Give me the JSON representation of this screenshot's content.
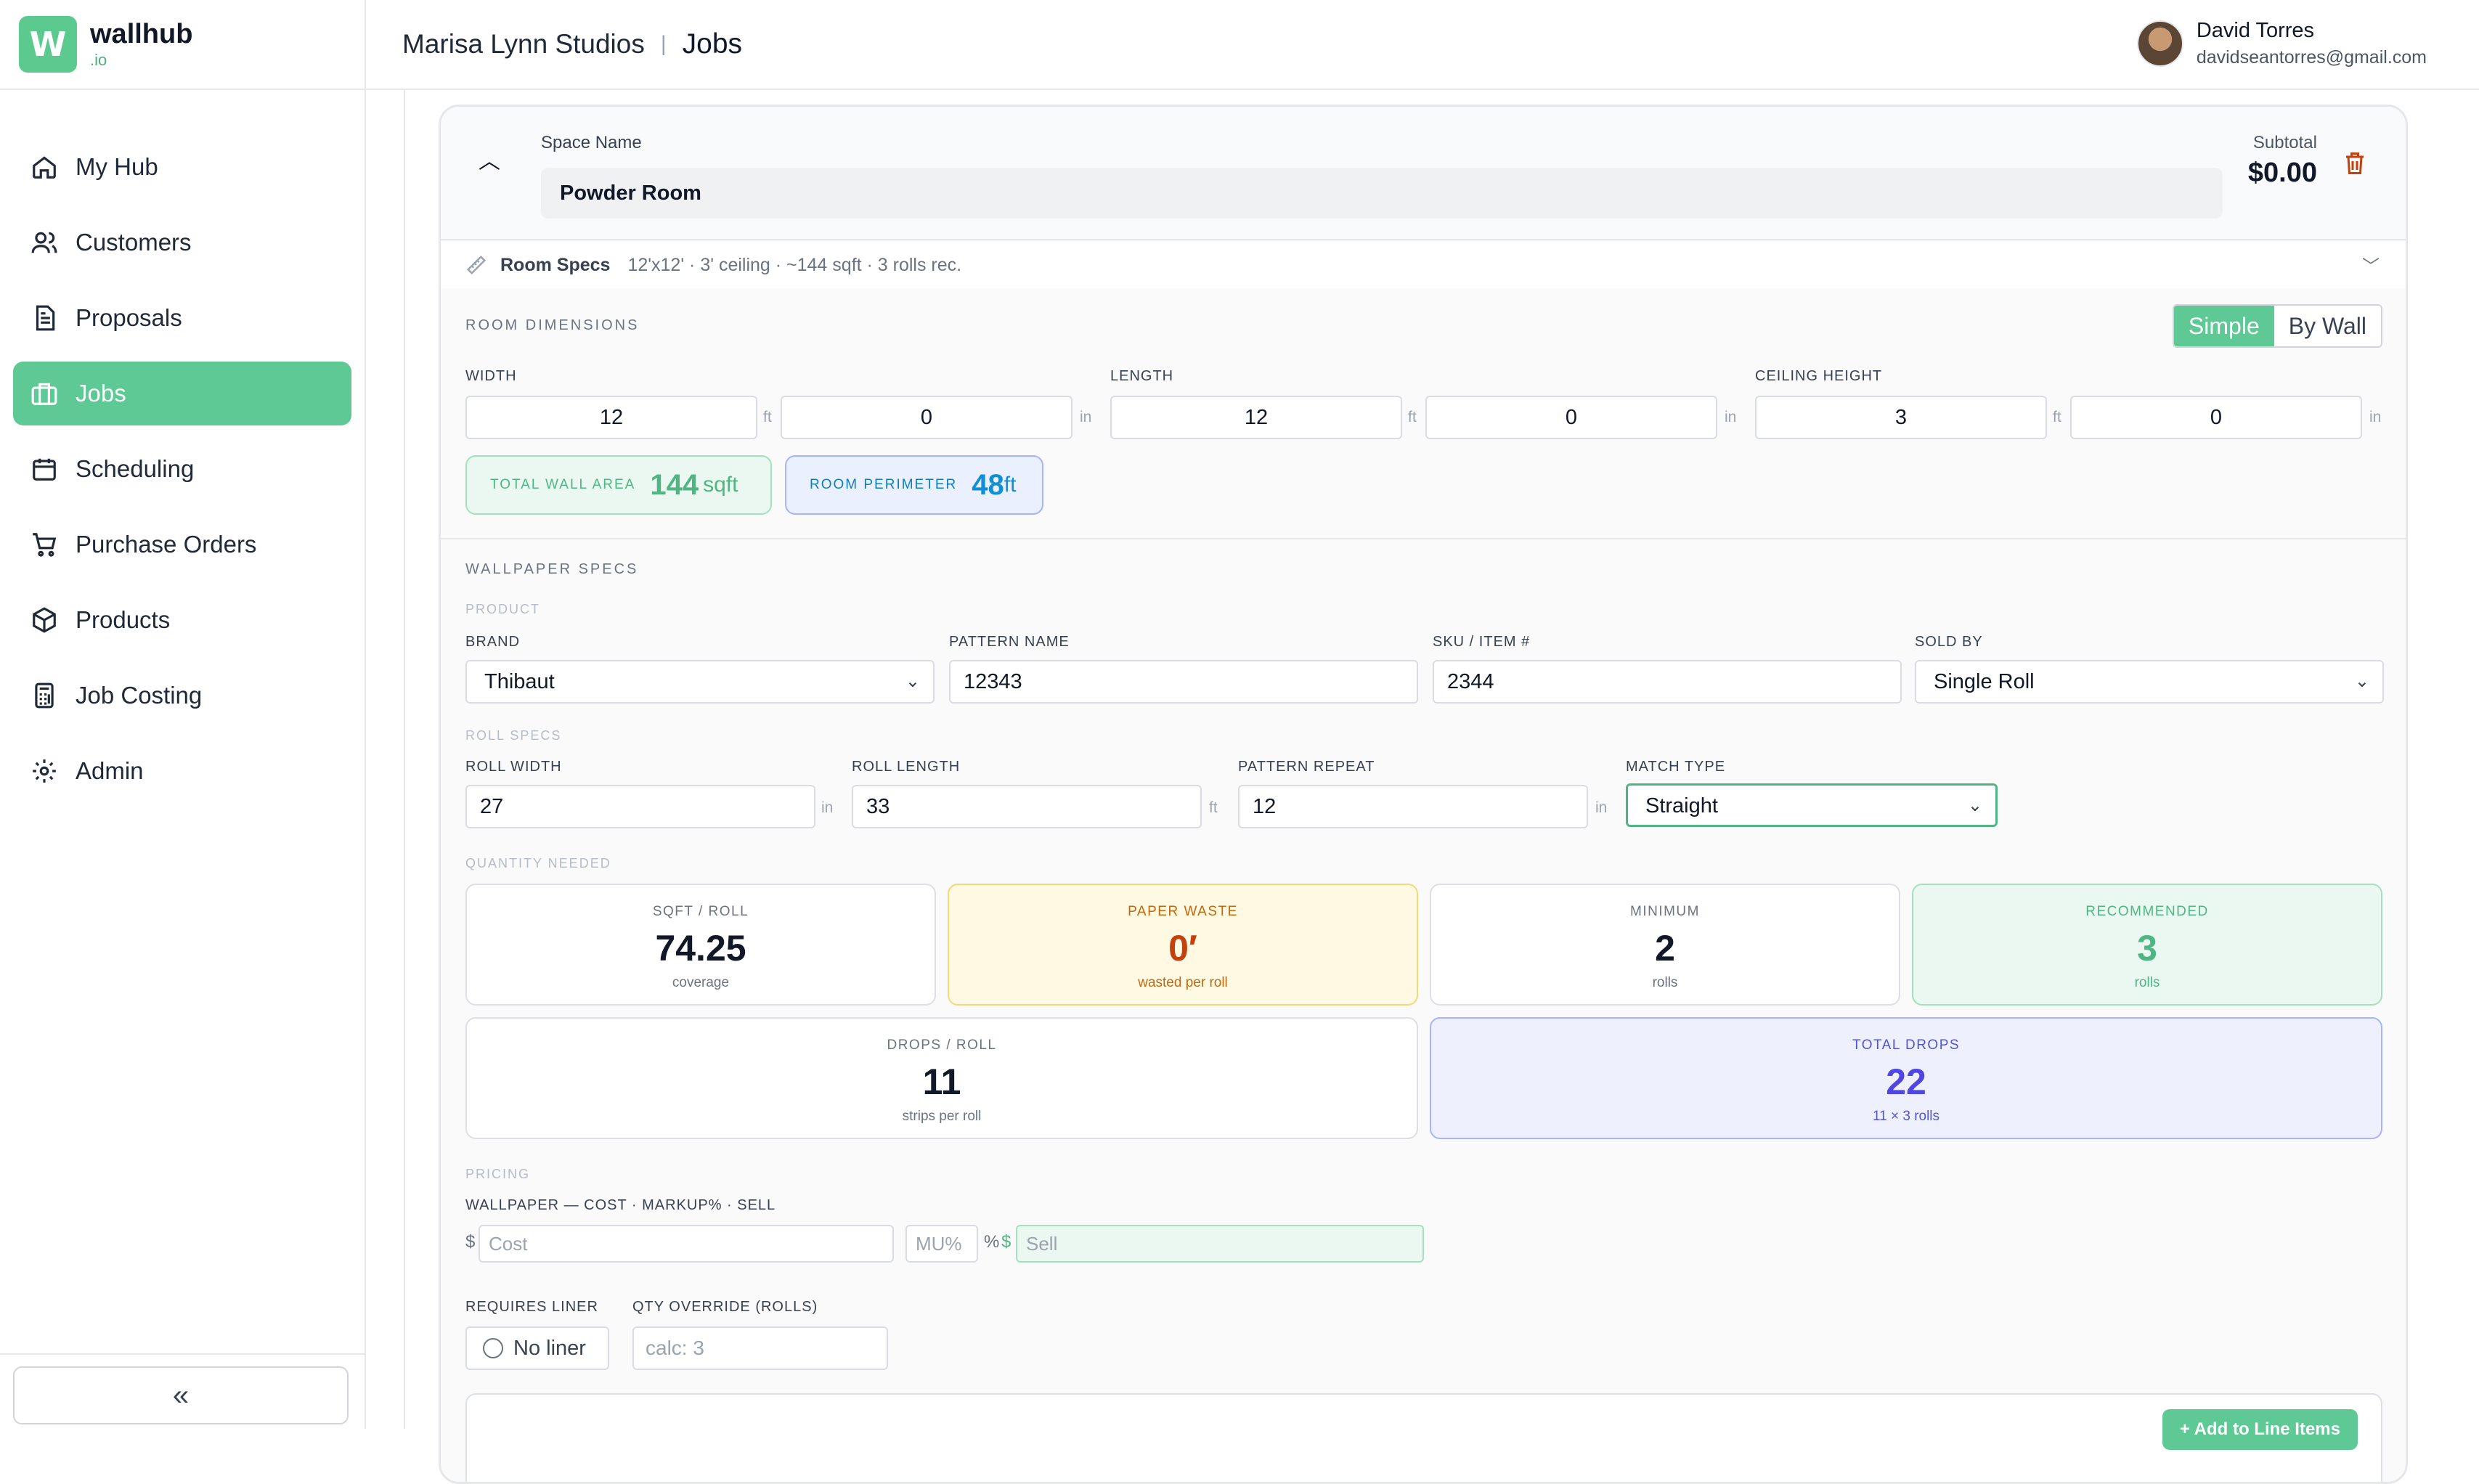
{
  "brand": {
    "name": "wallhub",
    "suffix": ".io",
    "logo": "W"
  },
  "nav": [
    {
      "label": "My Hub",
      "icon": "home-icon"
    },
    {
      "label": "Customers",
      "icon": "users-icon"
    },
    {
      "label": "Proposals",
      "icon": "document-icon"
    },
    {
      "label": "Jobs",
      "icon": "briefcase-icon",
      "active": true
    },
    {
      "label": "Scheduling",
      "icon": "calendar-icon"
    },
    {
      "label": "Purchase Orders",
      "icon": "cart-icon"
    },
    {
      "label": "Products",
      "icon": "box-icon"
    },
    {
      "label": "Job Costing",
      "icon": "calculator-icon"
    },
    {
      "label": "Admin",
      "icon": "gear-icon"
    }
  ],
  "collapse_label": "«",
  "header": {
    "org": "Marisa Lynn Studios",
    "sep": "|",
    "page": "Jobs"
  },
  "user": {
    "name": "David Torres",
    "email": "davidseantorres@gmail.com"
  },
  "space": {
    "label": "Space Name",
    "value": "Powder Room",
    "subtotal_label": "Subtotal",
    "subtotal": "$0.00"
  },
  "room_specs": {
    "title": "Room Specs",
    "summary": "12'x12' · 3' ceiling · ~144 sqft · 3 rolls rec."
  },
  "room_dimensions": {
    "title": "ROOM DIMENSIONS",
    "toggle": {
      "simple": "Simple",
      "by_wall": "By Wall",
      "selected": "Simple"
    },
    "width": {
      "label": "WIDTH",
      "ft": "12",
      "in": "0"
    },
    "length": {
      "label": "LENGTH",
      "ft": "12",
      "in": "0"
    },
    "ceiling": {
      "label": "CEILING HEIGHT",
      "ft": "3",
      "in": "0"
    },
    "unit_ft": "ft",
    "unit_in": "in",
    "wall_area": {
      "label": "TOTAL WALL AREA",
      "value": "144",
      "unit": "sqft"
    },
    "perimeter": {
      "label": "ROOM PERIMETER",
      "value": "48",
      "unit": "ft"
    }
  },
  "wallpaper": {
    "title": "WALLPAPER SPECS",
    "product_title": "PRODUCT",
    "brand": {
      "label": "BRAND",
      "value": "Thibaut"
    },
    "pattern": {
      "label": "PATTERN NAME",
      "value": "12343"
    },
    "sku": {
      "label": "SKU / ITEM #",
      "value": "2344"
    },
    "sold_by": {
      "label": "SOLD BY",
      "value": "Single Roll"
    },
    "roll_title": "ROLL SPECS",
    "roll_width": {
      "label": "ROLL WIDTH",
      "value": "27",
      "unit": "in"
    },
    "roll_length": {
      "label": "ROLL LENGTH",
      "value": "33",
      "unit": "ft"
    },
    "pattern_repeat": {
      "label": "PATTERN REPEAT",
      "value": "12",
      "unit": "in"
    },
    "match_type": {
      "label": "MATCH TYPE",
      "value": "Straight"
    }
  },
  "quantity": {
    "title": "QUANTITY NEEDED",
    "sqft_roll": {
      "label": "SQFT / ROLL",
      "value": "74.25",
      "sub": "coverage"
    },
    "waste": {
      "label": "PAPER WASTE",
      "value": "0′",
      "sub": "wasted per roll"
    },
    "minimum": {
      "label": "MINIMUM",
      "value": "2",
      "sub": "rolls"
    },
    "recommended": {
      "label": "RECOMMENDED",
      "value": "3",
      "sub": "rolls"
    },
    "drops_roll": {
      "label": "DROPS / ROLL",
      "value": "11",
      "sub": "strips per roll"
    },
    "total_drops": {
      "label": "TOTAL DROPS",
      "value": "22",
      "sub": "11 × 3 rolls"
    }
  },
  "pricing": {
    "title": "PRICING",
    "line_label": "WALLPAPER — COST · MARKUP% · SELL",
    "dollar": "$",
    "percent": "%",
    "cost_placeholder": "Cost",
    "markup_placeholder": "MU%",
    "sell_placeholder": "Sell",
    "liner_label": "REQUIRES LINER",
    "liner_value": "No liner",
    "qty_label": "QTY OVERRIDE (ROLLS)",
    "qty_placeholder": "calc: 3"
  },
  "add_button": "+ Add to Line Items",
  "colors": {
    "accent": "#5ec994",
    "waste": "#c2410c",
    "drops": "#5046e5",
    "perimeter": "#0e8fd6"
  }
}
